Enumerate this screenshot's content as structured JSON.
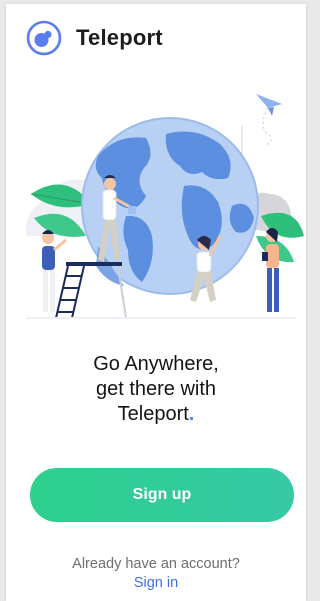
{
  "app": {
    "name": "Teleport",
    "logo_icon": "teleport-logo-icon"
  },
  "hero": {
    "illustration_icon": "globe-team-illustration",
    "headline_line1": "Go Anywhere,",
    "headline_line2": "get there with",
    "headline_line3": "Teleport",
    "headline_dot": "."
  },
  "actions": {
    "signup_label": "Sign up",
    "already_text": "Already have an account?",
    "signin_label": "Sign in"
  },
  "colors": {
    "accent_blue": "#5b7cf0",
    "signup_gradient_start": "#2dd08d",
    "signup_gradient_end": "#36c9a6",
    "link": "#3f6fe6"
  }
}
